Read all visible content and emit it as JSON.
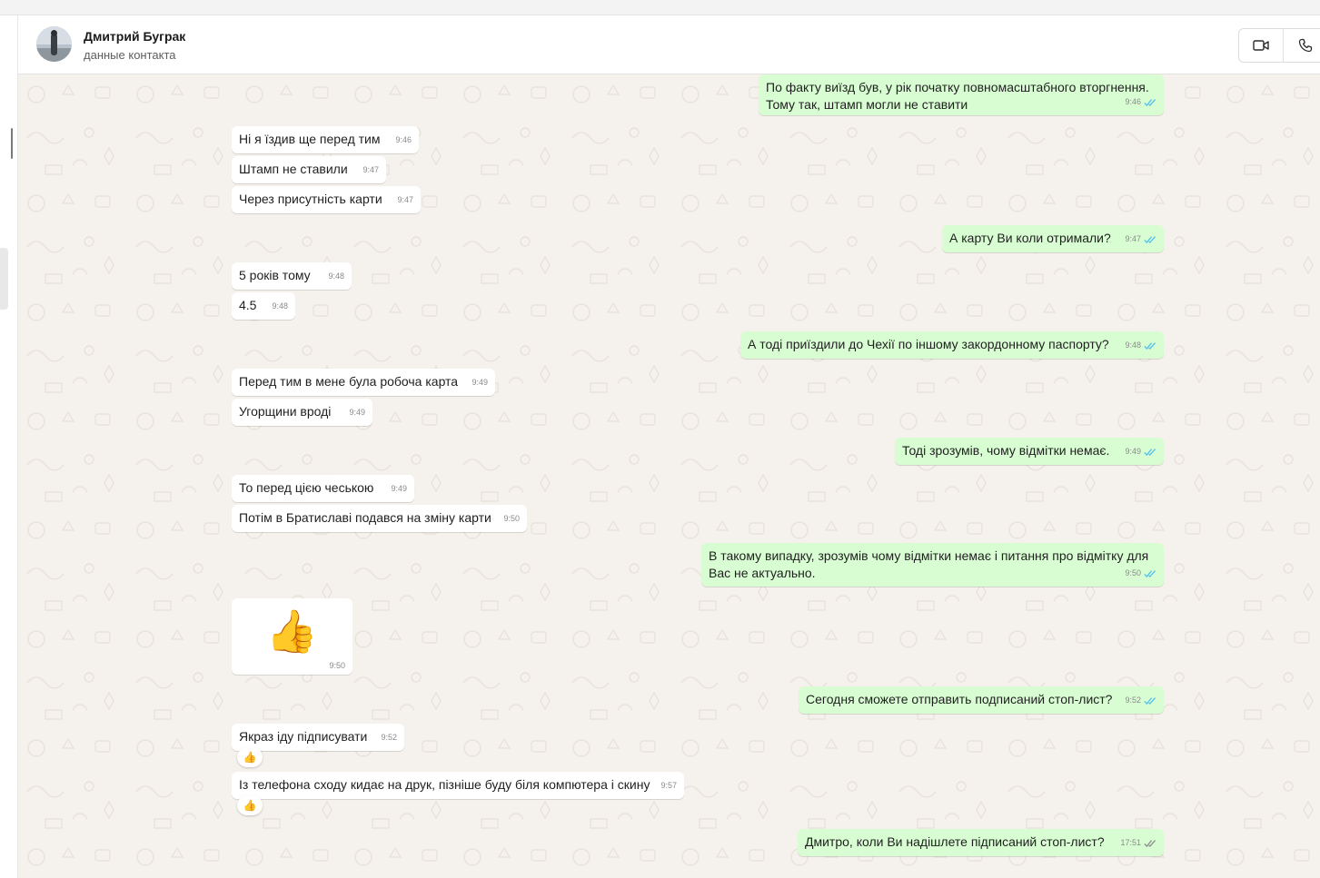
{
  "contact": {
    "name": "Дмитрий Буграк",
    "subtitle": "данные контакта"
  },
  "icons": {
    "video": "video-call-icon",
    "voice": "phone-call-icon",
    "read": "double-check-read-icon",
    "sent": "double-check-delivered-icon",
    "thumbs": "thumbs-up-emoji"
  },
  "colors": {
    "incoming_bubble": "#ffffff",
    "outgoing_bubble": "#d9fdd3",
    "read_ticks": "#53bdeb",
    "chat_background": "#f5f1ec"
  },
  "messages": [
    {
      "dir": "out",
      "text": "По факту виїзд був, у рік початку повномасштабного вторгнення.\nТому так, штамп могли не ставити",
      "time": "9:46",
      "status": "read"
    },
    {
      "dir": "in",
      "text": "Ні я їздив ще перед тим",
      "time": "9:46"
    },
    {
      "dir": "in",
      "text": "Штамп не ставили",
      "time": "9:47"
    },
    {
      "dir": "in",
      "text": "Через присутність карти",
      "time": "9:47"
    },
    {
      "dir": "out",
      "text": "А карту Ви коли отримали?",
      "time": "9:47",
      "status": "read"
    },
    {
      "dir": "in",
      "text": "5 років тому",
      "time": "9:48"
    },
    {
      "dir": "in",
      "text": "4.5",
      "time": "9:48"
    },
    {
      "dir": "out",
      "text": "А тоді приїздили до Чехії по іншому закордонному паспорту?",
      "time": "9:48",
      "status": "read"
    },
    {
      "dir": "in",
      "text": "Перед тим в мене була робоча карта",
      "time": "9:49"
    },
    {
      "dir": "in",
      "text": "Угорщини вроді",
      "time": "9:49"
    },
    {
      "dir": "out",
      "text": "Тоді зрозумів, чому відмітки немає.",
      "time": "9:49",
      "status": "read"
    },
    {
      "dir": "in",
      "text": "То перед цією чеською",
      "time": "9:49"
    },
    {
      "dir": "in",
      "text": "Потім в Братиславі подався на зміну карти",
      "time": "9:50"
    },
    {
      "dir": "out",
      "text": "В такому випадку, зрозумів чому відмітки немає і питання про відмітку для\nВас не актуально.",
      "time": "9:50",
      "status": "read"
    },
    {
      "dir": "in",
      "text": "",
      "time": "9:50",
      "sticker": "👍"
    },
    {
      "dir": "out",
      "text": "Сегодня сможете отправить подписаний стоп-лист?",
      "time": "9:52",
      "status": "read"
    },
    {
      "dir": "in",
      "text": "Якраз іду підписувати",
      "time": "9:52",
      "reaction": "👍"
    },
    {
      "dir": "in",
      "text": "Із телефона сходу кидає на друк, пізніше буду біля компютера і скину",
      "time": "9:57",
      "reaction": "👍"
    },
    {
      "dir": "out",
      "text": "Дмитро, коли Ви надішлете підписаний стоп-лист?",
      "time": "17:51",
      "status": "delivered"
    }
  ]
}
